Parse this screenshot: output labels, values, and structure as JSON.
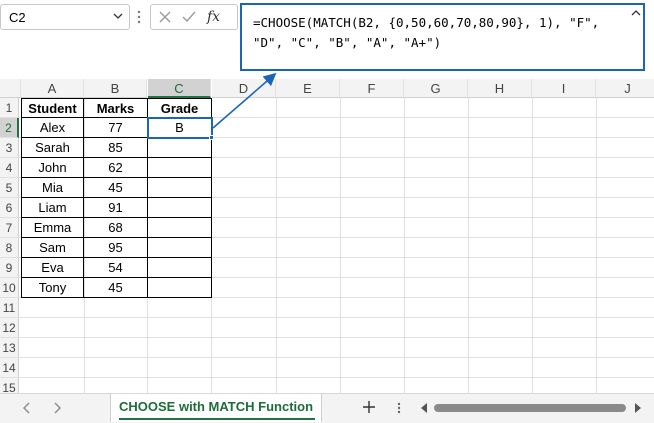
{
  "name_box": {
    "value": "C2"
  },
  "formula_bar": {
    "formula": "=CHOOSE(MATCH(B2, {0,50,60,70,80,90}, 1), \"F\", \"D\", \"C\", \"B\", \"A\", \"A+\")",
    "fx_label": "fx"
  },
  "columns": [
    "A",
    "B",
    "C",
    "D",
    "E",
    "F",
    "G",
    "H",
    "I",
    "J"
  ],
  "rows": [
    "1",
    "2",
    "3",
    "4",
    "5",
    "6",
    "7",
    "8",
    "9",
    "10",
    "11",
    "12",
    "13",
    "14",
    "15"
  ],
  "table": {
    "headers": [
      "Student",
      "Marks",
      "Grade"
    ],
    "rows": [
      {
        "student": "Alex",
        "marks": "77",
        "grade": "B"
      },
      {
        "student": "Sarah",
        "marks": "85",
        "grade": ""
      },
      {
        "student": "John",
        "marks": "62",
        "grade": ""
      },
      {
        "student": "Mia",
        "marks": "45",
        "grade": ""
      },
      {
        "student": "Liam",
        "marks": "91",
        "grade": ""
      },
      {
        "student": "Emma",
        "marks": "68",
        "grade": ""
      },
      {
        "student": "Sam",
        "marks": "95",
        "grade": ""
      },
      {
        "student": "Eva",
        "marks": "54",
        "grade": ""
      },
      {
        "student": "Tony",
        "marks": "45",
        "grade": ""
      }
    ]
  },
  "selection": {
    "cell": "C2",
    "column": "C",
    "row": "2"
  },
  "sheet_tab": {
    "label": "CHOOSE with MATCH Function"
  },
  "colors": {
    "accent_blue": "#1e64b4",
    "excel_green": "#217346"
  }
}
